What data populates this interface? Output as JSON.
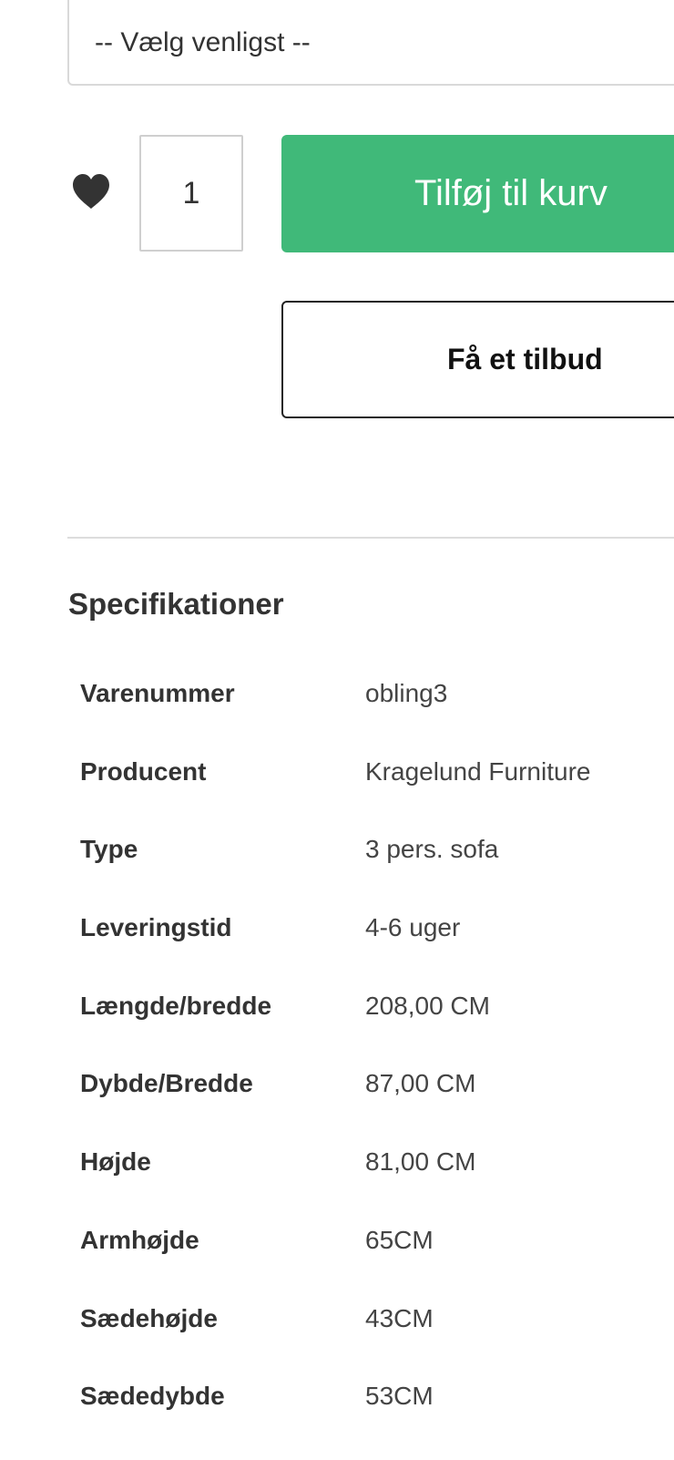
{
  "variant_select": {
    "selected": "-- Vælg venligst --"
  },
  "purchase": {
    "wishlist_icon": "heart-icon",
    "quantity": "1",
    "add_to_cart_label": "Tilføj til kurv",
    "add_to_cart_color": "#40b979",
    "quote_label": "Få et tilbud"
  },
  "specifications": {
    "heading": "Specifikationer",
    "rows": [
      {
        "label": "Varenummer",
        "value": "obling3"
      },
      {
        "label": "Producent",
        "value": "Kragelund Furniture"
      },
      {
        "label": "Type",
        "value": "3 pers. sofa"
      },
      {
        "label": "Leveringstid",
        "value": "4-6 uger"
      },
      {
        "label": "Længde/bredde",
        "value": "208,00 CM"
      },
      {
        "label": "Dybde/Bredde",
        "value": "87,00 CM"
      },
      {
        "label": "Højde",
        "value": "81,00 CM"
      },
      {
        "label": "Armhøjde",
        "value": "65CM"
      },
      {
        "label": "Sædehøjde",
        "value": "43CM"
      },
      {
        "label": "Sædedybde",
        "value": "53CM"
      }
    ]
  }
}
